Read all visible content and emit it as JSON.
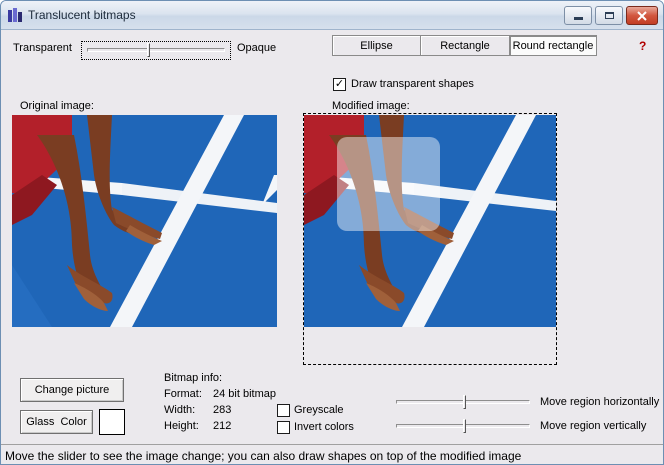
{
  "window": {
    "title": "Translucent bitmaps"
  },
  "titlebar_buttons": [
    "minimize-icon",
    "maximize-icon",
    "close-icon"
  ],
  "transparency": {
    "left_label": "Transparent",
    "right_label": "Opaque",
    "level": 0.45
  },
  "shapes": {
    "tabs": [
      "Ellipse",
      "Rectangle",
      "Round rectangle"
    ],
    "selected": "Round rectangle",
    "draw_transparent_label": "Draw transparent shapes",
    "draw_transparent_checked": true
  },
  "help": "?",
  "images": {
    "original_label": "Original image:",
    "modified_label": "Modified image:"
  },
  "buttons": {
    "change_picture": "Change picture",
    "glass_color": "Glass  Color"
  },
  "glass_color": "#ffffff",
  "bitmap_info": {
    "heading": "Bitmap info:",
    "format_label": "Format:",
    "format_value": "24 bit bitmap",
    "width_label": "Width:",
    "width_value": "283",
    "height_label": "Height:",
    "height_value": "212"
  },
  "options": {
    "greyscale": "Greyscale",
    "invert": "Invert colors"
  },
  "move_region": {
    "horizontal_label": "Move region horizontally",
    "vertical_label": "Move region vertically",
    "horizontal_level": 0.5,
    "vertical_level": 0.5
  },
  "status": "Move the slider to see the image change; you can also draw shapes on top of the modified image",
  "colors": {
    "track_blue": "#1f66b8",
    "lane_white": "#f4f6f9",
    "skin": "#8a4a2a",
    "shirt_red": "#b3202a",
    "help_red": "#b00000"
  }
}
